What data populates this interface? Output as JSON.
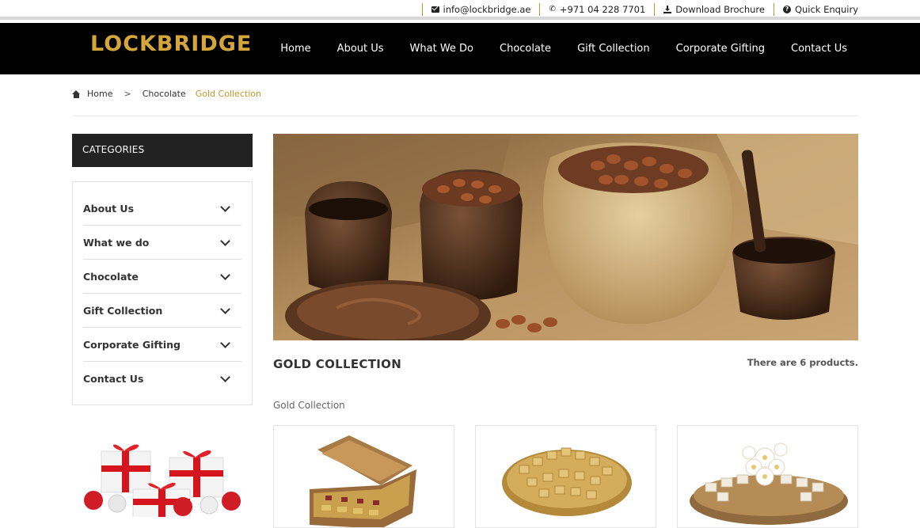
{
  "topbar": {
    "email": "info@lockbridge.ae",
    "phone": "+971 04 228 7701",
    "brochure": "Download Brochure",
    "enquiry": "Quick Enquiry"
  },
  "header": {
    "logo": "LOCKBRIDGE",
    "nav": [
      "Home",
      "About Us",
      "What We Do",
      "Chocolate",
      "Gift Collection",
      "Corporate Gifting",
      "Contact Us"
    ]
  },
  "breadcrumb": {
    "home": "Home",
    "sep": ">",
    "parent": "Chocolate",
    "current": "Gold Collection"
  },
  "sidebar": {
    "heading": "CATEGORIES",
    "items": [
      "About Us",
      "What we do",
      "Chocolate",
      "Gift Collection",
      "Corporate Gifting",
      "Contact Us"
    ]
  },
  "main": {
    "title": "GOLD COLLECTION",
    "count": "There are 6 products.",
    "subcategory": "Gold Collection"
  },
  "colors": {
    "accent": "#c9962f",
    "header_bg": "#000000",
    "logo": "#d5a63a"
  }
}
